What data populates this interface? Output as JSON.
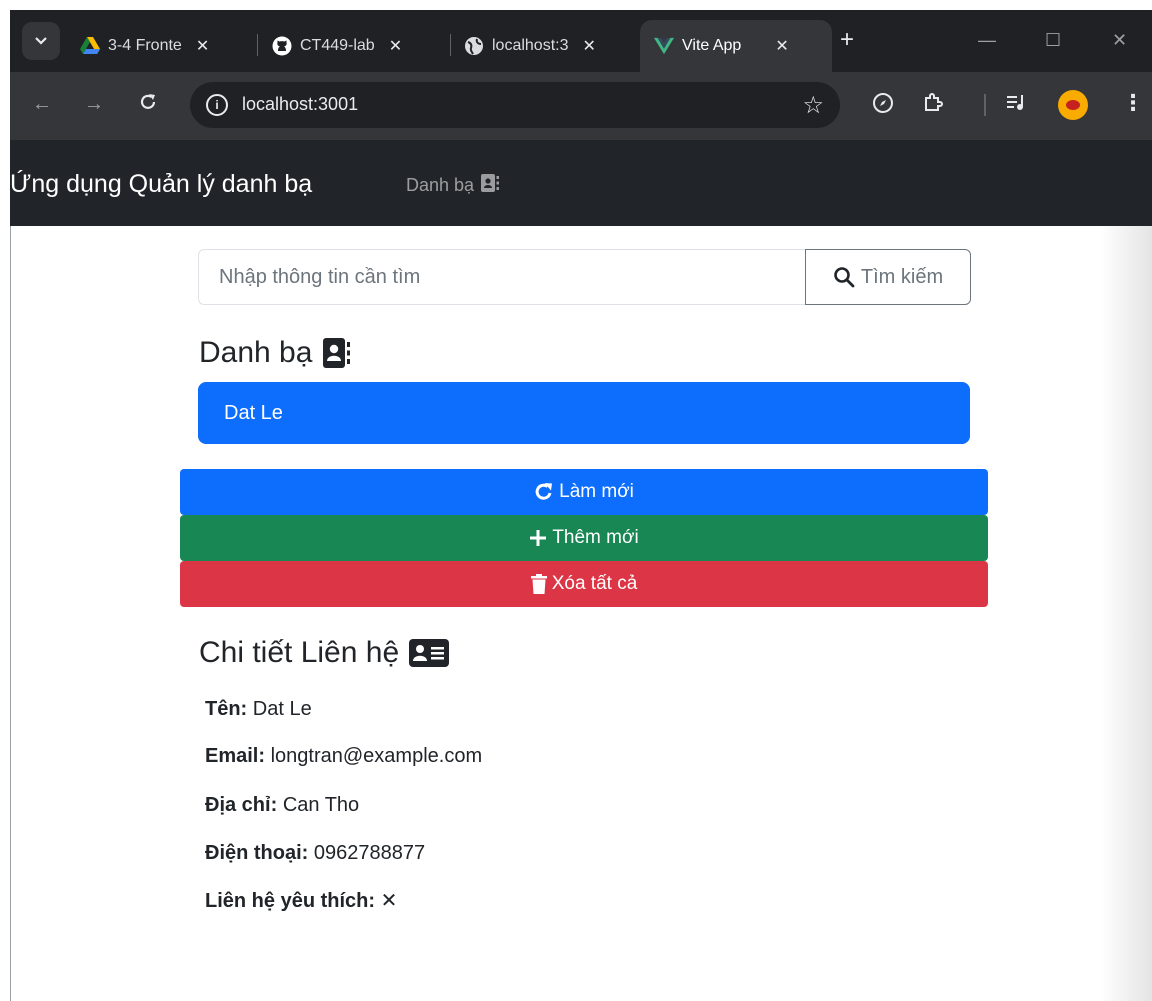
{
  "browser": {
    "tabs": [
      {
        "title": "3-4 Fronte",
        "favicon": "google-drive-icon",
        "active": false
      },
      {
        "title": "CT449-lab",
        "favicon": "github-icon",
        "active": false
      },
      {
        "title": "localhost:3",
        "favicon": "globe-icon",
        "active": false
      },
      {
        "title": "Vite App",
        "favicon": "vue-icon",
        "active": true
      }
    ],
    "new_tab_label": "+",
    "close_glyph": "✕",
    "url": "localhost:3001"
  },
  "navbar": {
    "brand": "Ứng dụng Quản lý danh bạ",
    "link_contacts": "Danh bạ"
  },
  "search": {
    "placeholder": "Nhập thông tin cần tìm",
    "button_label": "Tìm kiếm"
  },
  "contacts_section": {
    "heading": "Danh bạ",
    "items": [
      {
        "name": "Dat Le",
        "active": true
      }
    ]
  },
  "actions": {
    "refresh_label": "Làm mới",
    "add_label": "Thêm mới",
    "clear_label": "Xóa tất cả"
  },
  "detail_section": {
    "heading": "Chi tiết Liên hệ",
    "fields": [
      {
        "label": "Tên:",
        "value": "Dat Le"
      },
      {
        "label": "Email:",
        "value": "longtran@example.com"
      },
      {
        "label": "Địa chỉ:",
        "value": "Can Tho"
      },
      {
        "label": "Điện thoại:",
        "value": "0962788877"
      },
      {
        "label": "Liên hệ yêu thích:",
        "value": "✕"
      }
    ]
  },
  "colors": {
    "primary": "#0d6efd",
    "success": "#198754",
    "danger": "#dc3545",
    "navbar_bg": "#212529"
  }
}
